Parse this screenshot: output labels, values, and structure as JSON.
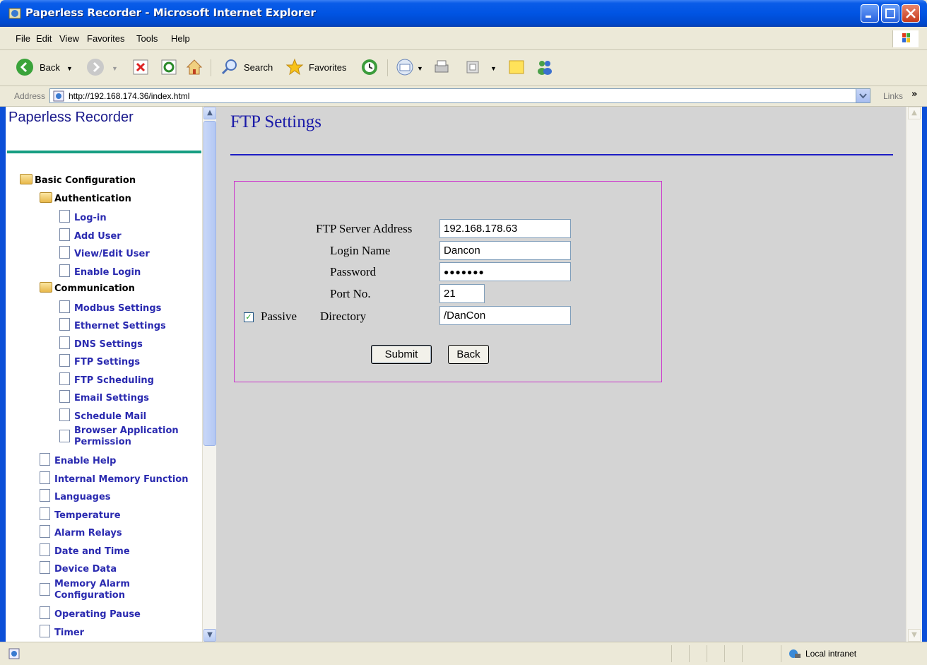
{
  "window": {
    "title": "Paperless Recorder - Microsoft Internet Explorer"
  },
  "menu": [
    "File",
    "Edit",
    "View",
    "Favorites",
    "Tools",
    "Help"
  ],
  "toolbar": {
    "back": "Back",
    "search": "Search",
    "favorites": "Favorites"
  },
  "address": {
    "label": "Address",
    "url": "http://192.168.174.36/index.html",
    "links": "Links"
  },
  "sidebar": {
    "title": "Paperless Recorder",
    "basic_configuration": "Basic Configuration",
    "authentication": "Authentication",
    "auth_items": [
      "Log-in",
      "Add User",
      "View/Edit User",
      "Enable Login"
    ],
    "communication": "Communication",
    "comm_items": [
      "Modbus Settings",
      "Ethernet Settings",
      "DNS Settings",
      "FTP Settings",
      "FTP Scheduling",
      "Email Settings",
      "Schedule Mail"
    ],
    "browser_app_line1": "Browser Application",
    "browser_app_line2": "Permission",
    "root_items": [
      "Enable Help",
      "Internal Memory Function",
      "Languages",
      "Temperature",
      "Alarm Relays",
      "Date and Time",
      "Device Data"
    ],
    "memory_alarm_line1": "Memory Alarm",
    "memory_alarm_line2": "Configuration",
    "root_items2": [
      "Operating Pause",
      "Timer"
    ]
  },
  "page": {
    "title": "FTP Settings",
    "form": {
      "server_label": "FTP Server Address",
      "server_value": "192.168.178.63",
      "login_label": "Login Name",
      "login_value": "Dancon",
      "password_label": "Password",
      "password_value": "●●●●●●●",
      "port_label": "Port No.",
      "port_value": "21",
      "passive_label": "Passive",
      "passive_checked": true,
      "directory_label": "Directory",
      "directory_value": "/DanCon",
      "submit": "Submit",
      "back": "Back"
    }
  },
  "status": {
    "zone": "Local intranet"
  }
}
